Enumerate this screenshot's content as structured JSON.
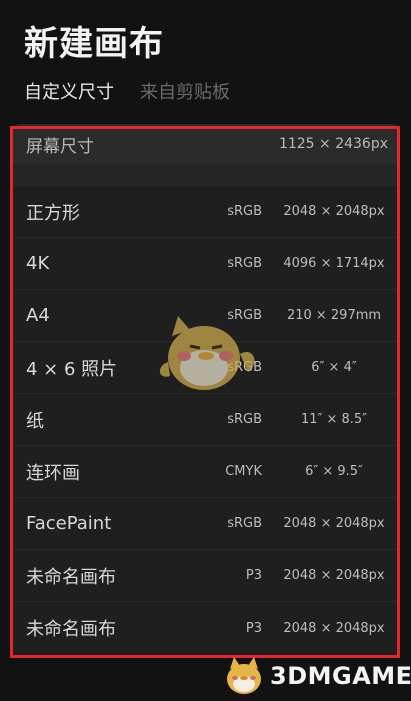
{
  "header": {
    "title": "新建画布",
    "tabs": [
      {
        "label": "自定义尺寸",
        "active": true
      },
      {
        "label": "来自剪贴板",
        "active": false
      }
    ]
  },
  "screen_size": {
    "label": "屏幕尺寸",
    "dimensions": "1125 × 2436px"
  },
  "presets": [
    {
      "name": "正方形",
      "color_space": "sRGB",
      "size": "2048 × 2048px"
    },
    {
      "name": "4K",
      "color_space": "sRGB",
      "size": "4096 × 1714px"
    },
    {
      "name": "A4",
      "color_space": "sRGB",
      "size": "210 × 297mm"
    },
    {
      "name": "4 × 6 照片",
      "color_space": "sRGB",
      "size": "6″ × 4″"
    },
    {
      "name": "纸",
      "color_space": "sRGB",
      "size": "11″ × 8.5″"
    },
    {
      "name": "连环画",
      "color_space": "CMYK",
      "size": "6″ × 9.5″"
    },
    {
      "name": "FacePaint",
      "color_space": "sRGB",
      "size": "2048 × 2048px"
    },
    {
      "name": "未命名画布",
      "color_space": "P3",
      "size": "2048 × 2048px"
    },
    {
      "name": "未命名画布",
      "color_space": "P3",
      "size": "2048 × 2048px"
    }
  ],
  "watermark": {
    "text": "3DMGAME"
  },
  "colors": {
    "background": "#121212",
    "panel": "#1f1f1f",
    "highlight_border": "#e5272d"
  }
}
